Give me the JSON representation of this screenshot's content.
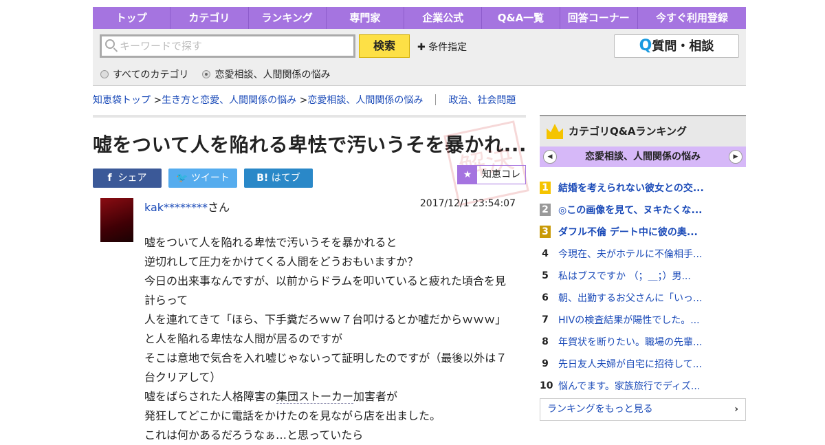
{
  "nav": [
    "トップ",
    "カテゴリ",
    "ランキング",
    "専門家",
    "企業公式",
    "Q&A一覧",
    "回答コーナー",
    "今すぐ利用登録"
  ],
  "search": {
    "placeholder": "キーワードで探す",
    "button": "検索",
    "conditions": "条件指定",
    "ask_q": "Q",
    "ask": "質問・相談",
    "radio_all": "すべてのカテゴリ",
    "radio_cat": "恋愛相談、人間関係の悩み"
  },
  "breadcrumb": [
    "知恵袋トップ",
    "生き方と恋愛、人間関係の悩み",
    "恋愛相談、人間関係の悩み",
    "政治、社会問題"
  ],
  "question": {
    "title": "嘘をついて人を陥れる卑怯で汚いうそを暴かれ...",
    "share": "シェア",
    "tweet": "ツイート",
    "hatebu": "はてブ",
    "hatebu_icon": "B!",
    "collect": "知恵コレ",
    "user": "kak********",
    "user_suffix": "さん",
    "date": "2017/12/1  23:54:07",
    "body": [
      "嘘をついて人を陥れる卑怯で汚いうそを暴かれると",
      "逆切れして圧力をかけてくる人間をどうおもいますか？",
      "今日の出来事なんですが、以前からドラムを叩いていると疲れた頃合を見計らって",
      "人を連れてきて「ほら、下手糞だろｗｗ７台叩けるとか嘘だからｗｗｗ」",
      "と人を陥れる卑怯な人間が居るのですが",
      "そこは意地で気合を入れ嘘じゃないって証明したのですが（最後以外は７台クリアして）"
    ],
    "line7_pre": "嘘をばらされた人格障害の",
    "line7_link": "集団ストーカー",
    "line7_post": "加害者が",
    "line8": "発狂してどこかに電話をかけたのを見ながら店を出ました。",
    "line9": "これは何かあるだろうなぁ…と思っていたら"
  },
  "sidebar": {
    "title": "カテゴリQ&Aランキング",
    "category": "恋愛相談、人間関係の悩み",
    "items": [
      {
        "rank": "1",
        "text": "結婚を考えられない彼女との交..."
      },
      {
        "rank": "2",
        "text": "◎この画像を見て、ヌキたくな..."
      },
      {
        "rank": "3",
        "text": "ダフル不倫 デート中に彼の奥..."
      },
      {
        "rank": "4",
        "text": "今現在、夫がホテルに不倫相手..."
      },
      {
        "rank": "5",
        "text": "私はブスですか （；＿；）男..."
      },
      {
        "rank": "6",
        "text": "朝、出勤するお父さんに「いっ..."
      },
      {
        "rank": "7",
        "text": "HIVの検査結果が陽性でした。..."
      },
      {
        "rank": "8",
        "text": "年賀状を断りたい。職場の先輩..."
      },
      {
        "rank": "9",
        "text": "先日友人夫婦が自宅に招待して..."
      },
      {
        "rank": "10",
        "text": "悩んでます。家族旅行でディズ..."
      }
    ],
    "more": "ランキングをもっと見る"
  }
}
